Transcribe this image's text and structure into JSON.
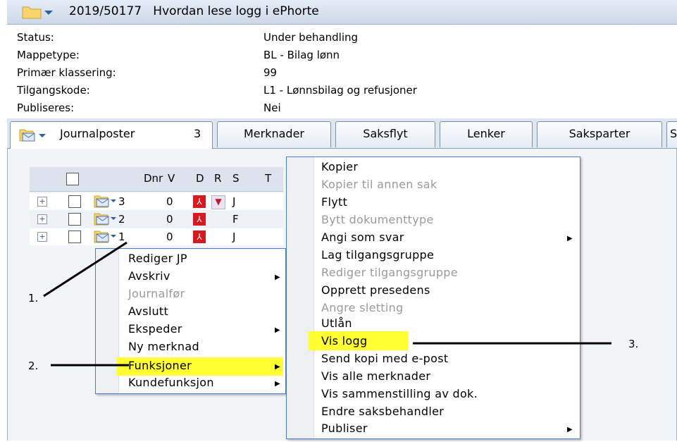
{
  "header": {
    "case_number": "2019/50177",
    "case_title": "Hvordan lese logg i ePhorte"
  },
  "properties": [
    {
      "label": "Status:",
      "value": "Under behandling"
    },
    {
      "label": "Mappetype:",
      "value": "BL - Bilag lønn"
    },
    {
      "label": "Primær klassering:",
      "value": "99"
    },
    {
      "label": "Tilgangskode:",
      "value": "L1 - Lønnsbilag og refusjoner"
    },
    {
      "label": "Publiseres:",
      "value": "Nei"
    }
  ],
  "tabs": [
    {
      "label": "Journalposter",
      "count": "3"
    },
    {
      "label": "Merknader"
    },
    {
      "label": "Saksflyt"
    },
    {
      "label": "Lenker"
    },
    {
      "label": "Saksparter"
    },
    {
      "label": "S"
    }
  ],
  "grid": {
    "columns": {
      "dnr": "Dnr",
      "v": "V",
      "d": "D",
      "r": "R",
      "s": "S",
      "t": "T"
    },
    "rows": [
      {
        "dnr": "3",
        "v": "0",
        "s": "J",
        "flag": true
      },
      {
        "dnr": "2",
        "v": "0",
        "s": "F",
        "flag": false
      },
      {
        "dnr": "1",
        "v": "0",
        "s": "J",
        "flag": false
      }
    ]
  },
  "context_menu": {
    "items": [
      {
        "label": "Rediger JP",
        "disabled": false,
        "submenu": false
      },
      {
        "label": "Avskriv",
        "disabled": false,
        "submenu": true
      },
      {
        "label": "Journalfør",
        "disabled": true,
        "submenu": false
      },
      {
        "label": "Avslutt",
        "disabled": false,
        "submenu": false
      },
      {
        "label": "Ekspeder",
        "disabled": false,
        "submenu": true
      },
      {
        "label": "Ny merknad",
        "disabled": false,
        "submenu": false
      },
      {
        "label": "Funksjoner",
        "disabled": false,
        "submenu": true,
        "highlighted": true
      },
      {
        "label": "Kundefunksjon",
        "disabled": false,
        "submenu": true
      }
    ]
  },
  "submenu": {
    "items": [
      {
        "label": "Kopier",
        "disabled": false,
        "submenu": false
      },
      {
        "label": "Kopier til annen sak",
        "disabled": true,
        "submenu": false
      },
      {
        "label": "Flytt",
        "disabled": false,
        "submenu": false
      },
      {
        "label": "Bytt dokumenttype",
        "disabled": true,
        "submenu": false
      },
      {
        "label": "Angi som svar",
        "disabled": false,
        "submenu": true
      },
      {
        "label": "Lag tilgangsgruppe",
        "disabled": false,
        "submenu": false
      },
      {
        "label": "Rediger tilgangsgruppe",
        "disabled": true,
        "submenu": false
      },
      {
        "label": "Opprett presedens",
        "disabled": false,
        "submenu": false
      },
      {
        "label": "Angre sletting",
        "disabled": true,
        "submenu": false
      },
      {
        "label": "Utlån",
        "disabled": false,
        "submenu": false
      },
      {
        "label": "Vis logg",
        "disabled": false,
        "submenu": false,
        "highlighted": true
      },
      {
        "label": "Send kopi med e-post",
        "disabled": false,
        "submenu": false
      },
      {
        "label": "Vis alle merknader",
        "disabled": false,
        "submenu": false
      },
      {
        "label": "Vis sammenstilling av dok.",
        "disabled": false,
        "submenu": false
      },
      {
        "label": "Endre saksbehandler",
        "disabled": false,
        "submenu": false
      },
      {
        "label": "Publiser",
        "disabled": false,
        "submenu": true
      }
    ]
  },
  "annotations": {
    "step1": "1.",
    "step2": "2.",
    "step3": "3."
  },
  "colors": {
    "highlight": "#ffff33",
    "menu_border": "#4a7fd0",
    "pdf_red": "#d71920"
  },
  "icons": {
    "folder": "folder-icon",
    "dropdown": "chevron-down-icon",
    "document": "document-envelope-icon",
    "pdf": "pdf-icon",
    "flag": "flag-icon"
  }
}
